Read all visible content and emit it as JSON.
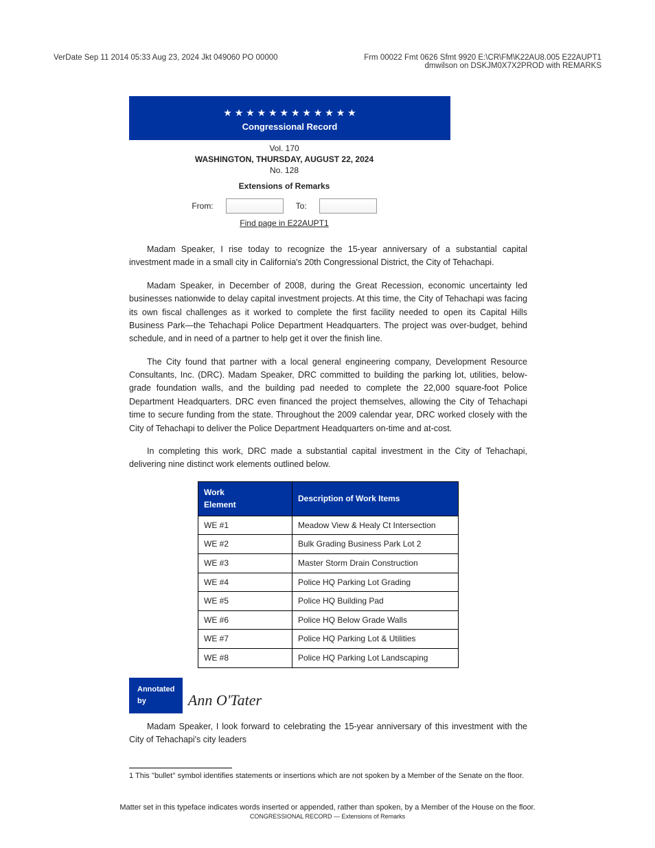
{
  "header": {
    "left_line1": "VerDate Sep 11 2014   05:33 Aug 23, 2024   Jkt 049060   PO 00000",
    "right_line1": "Frm 00022   Fmt 0626   Sfmt 9920   E:\\CR\\FM\\K22AU8.005   E22AUPT1",
    "right_line2": "dmwilson on DSKJM0X7X2PROD with REMARKS"
  },
  "banner": {
    "title": "Congressional Record"
  },
  "subhead": {
    "vol_line": "Vol. 170",
    "desc_line": "WASHINGTON, THURSDAY, AUGUST 22, 2024",
    "no_line": "No. 128",
    "extensions": "Extensions of Remarks"
  },
  "form": {
    "from_label": "From:",
    "to_label": "To:",
    "find_label": "Find page in E22AUPT1"
  },
  "paragraphs": {
    "p1": "Madam Speaker, I rise today to recognize the 15-year anniversary of a substantial capital investment made in a small city in California's 20th Congressional District, the City of Tehachapi.",
    "p2": "Madam Speaker, in December of 2008, during the Great Recession, economic uncertainty led businesses nationwide to delay capital investment projects. At this time, the City of Tehachapi was facing its own fiscal challenges as it worked to complete the first facility needed to open its Capital Hills Business Park—the Tehachapi Police Department Headquarters. The project was over-budget, behind schedule, and in need of a partner to help get it over the finish line.",
    "p3": "The City found that partner with a local general engineering company, Development Resource Consultants, Inc. (DRC). Madam Speaker, DRC committed to building the parking lot, utilities, below-grade foundation walls, and the building pad needed to complete the 22,000 square-foot Police Department Headquarters. DRC even financed the project themselves, allowing the City of Tehachapi time to secure funding from the state. Throughout the 2009 calendar year, DRC worked closely with the City of Tehachapi to deliver the Police Department Headquarters on-time and at-cost.",
    "table_intro": "In completing this work, DRC made a substantial capital investment in the City of Tehachapi, delivering nine distinct work elements outlined below."
  },
  "table": {
    "headers": [
      "Work\nElement",
      "Description of Work Items"
    ],
    "rows": [
      [
        "WE #1",
        "Meadow View & Healy Ct Intersection"
      ],
      [
        "WE #2",
        "Bulk Grading Business Park Lot 2"
      ],
      [
        "WE #3",
        "Master Storm Drain Construction"
      ],
      [
        "WE #4",
        "Police HQ Parking Lot Grading"
      ],
      [
        "WE #5",
        "Police HQ Building Pad"
      ],
      [
        "WE #6",
        "Police HQ Below Grade Walls"
      ],
      [
        "WE #7",
        "Police HQ Parking Lot & Utilities"
      ],
      [
        "WE #8",
        "Police HQ Parking Lot Landscaping"
      ]
    ]
  },
  "closing": {
    "p": "Madam Speaker, I look forward to celebrating the 15-year anniversary of this investment with the City of Tehachapi's city leaders"
  },
  "annotation": {
    "label": "Annotated\nby",
    "signature": "Ann O'Tater"
  },
  "footnote": {
    "marker": "1",
    "text": "This ''bullet'' symbol identifies statements or insertions which are not spoken by a Member of the Senate on the floor."
  },
  "footer": {
    "line1": "Matter set in this typeface indicates words inserted or appended, rather than spoken, by a Member of the House on the floor.",
    "line2": "CONGRESSIONAL RECORD — Extensions of Remarks"
  }
}
